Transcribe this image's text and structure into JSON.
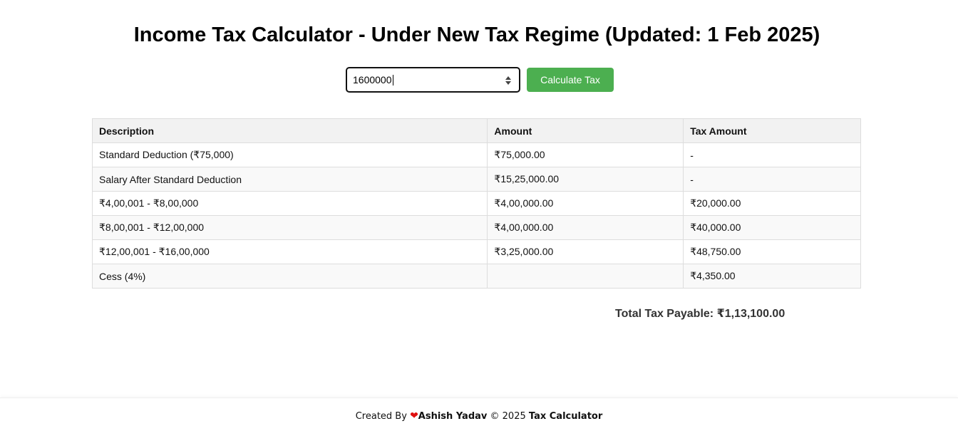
{
  "page": {
    "title": "Income Tax Calculator - Under New Tax Regime (Updated: 1 Feb 2025)"
  },
  "form": {
    "salary_value": "1600000",
    "calculate_label": "Calculate Tax",
    "button_color": "#4caf50"
  },
  "table": {
    "headers": [
      "Description",
      "Amount",
      "Tax Amount"
    ],
    "rows": [
      {
        "description": "Standard Deduction (₹75,000)",
        "amount": "₹75,000.00",
        "tax": "-"
      },
      {
        "description": "Salary After Standard Deduction",
        "amount": "₹15,25,000.00",
        "tax": "-"
      },
      {
        "description": "₹4,00,001 - ₹8,00,000",
        "amount": "₹4,00,000.00",
        "tax": "₹20,000.00"
      },
      {
        "description": "₹8,00,001 - ₹12,00,000",
        "amount": "₹4,00,000.00",
        "tax": "₹40,000.00"
      },
      {
        "description": "₹12,00,001 - ₹16,00,000",
        "amount": "₹3,25,000.00",
        "tax": "₹48,750.00"
      },
      {
        "description": "Cess (4%)",
        "amount": "",
        "tax": "₹4,350.00"
      }
    ]
  },
  "total": {
    "text": "Total Tax Payable: ₹1,13,100.00"
  },
  "footer": {
    "prefix": "Created By",
    "heart_icon": "heart-icon",
    "author": "Ashish Yadav",
    "copyright": "© 2025",
    "app_name": "Tax Calculator",
    "heart_color": "#e01010"
  }
}
